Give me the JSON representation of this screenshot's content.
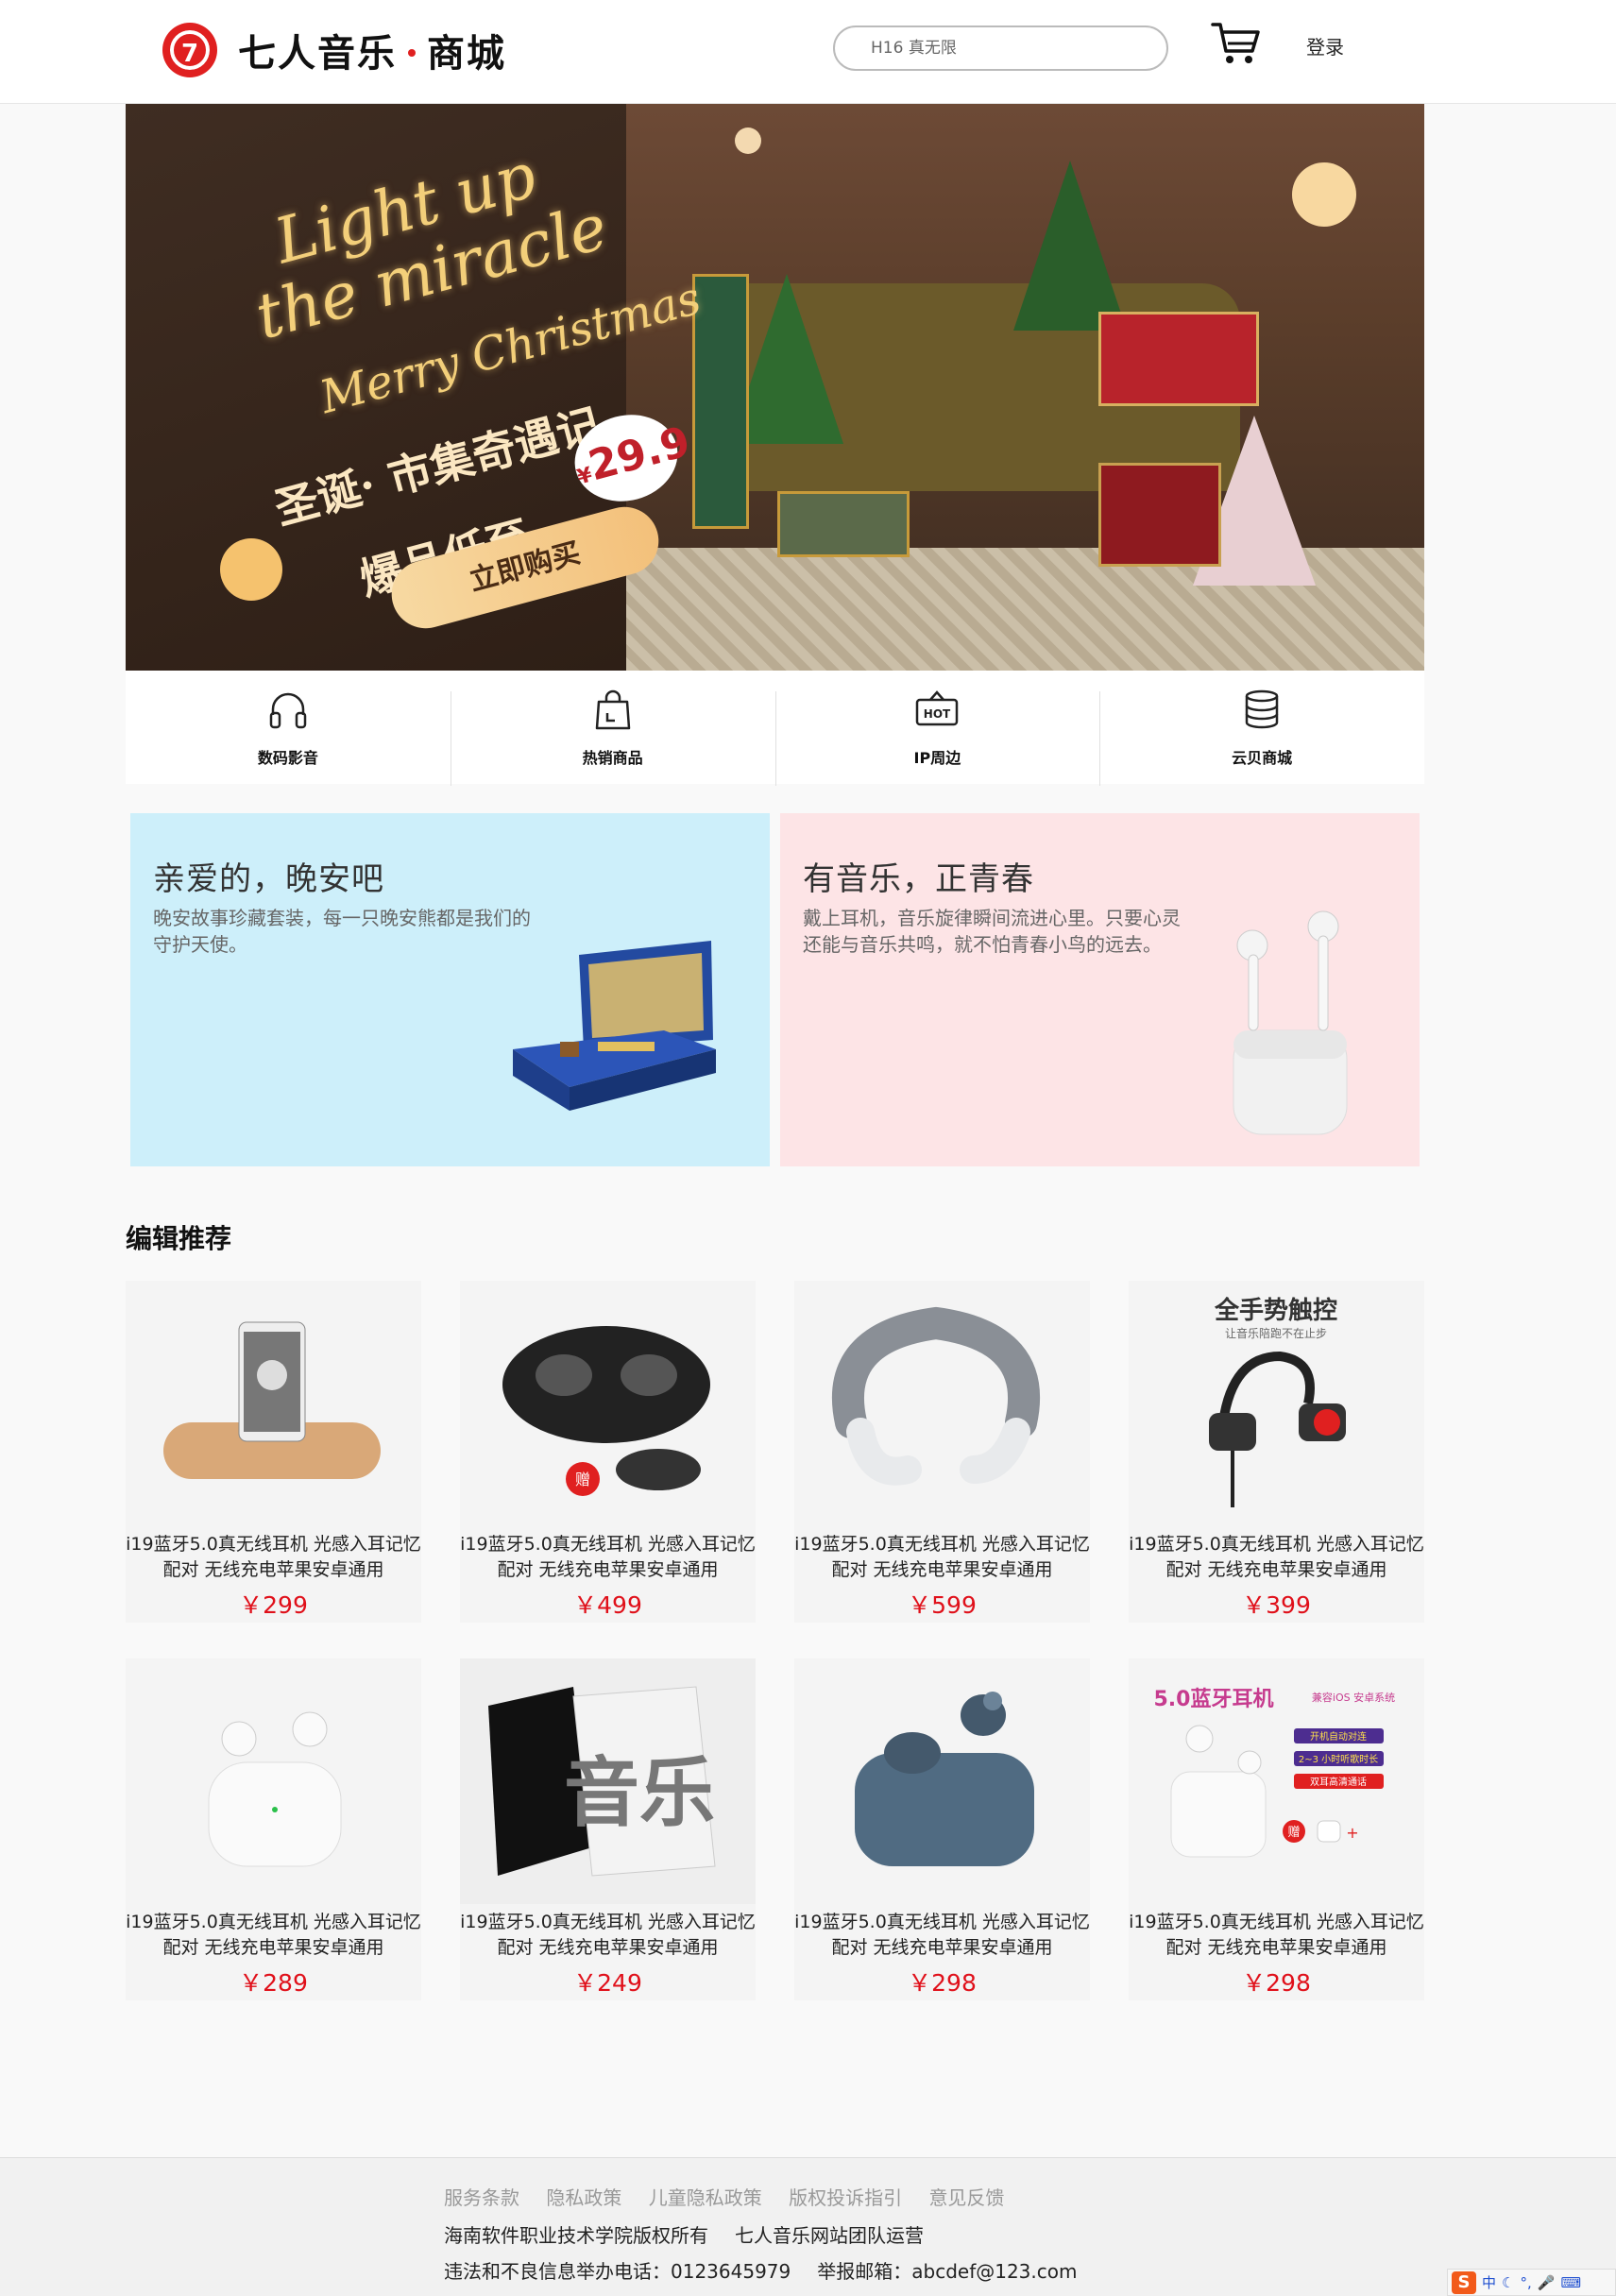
{
  "header": {
    "logo_mark": "7",
    "brand": "七人音乐",
    "brand_suffix": "商城",
    "search_placeholder": "H16 真无限",
    "login_label": "登录",
    "cart_icon": "cart-icon"
  },
  "banner": {
    "line1": "Light up",
    "line2": "the miracle",
    "line3": "Merry Christmas",
    "cn1": "圣诞· 市集奇遇记",
    "cn2": "爆品低至",
    "currency": "¥",
    "price": "29.9",
    "cta": "立即购买"
  },
  "categories": [
    {
      "label": "数码影音",
      "icon": "headphones-icon"
    },
    {
      "label": "热销商品",
      "icon": "shopping-bag-icon"
    },
    {
      "label": "IP周边",
      "icon": "hot-sign-icon"
    },
    {
      "label": "云贝商城",
      "icon": "coins-stack-icon"
    }
  ],
  "promos": [
    {
      "title": "亲爱的，晚安吧",
      "desc": "晚安故事珍藏套装，每一只晚安熊都是我们的守护天使。",
      "bg": "#cdeffa"
    },
    {
      "title": "有音乐，正青春",
      "desc": "戴上耳机，音乐旋律瞬间流进心里。只要心灵还能与音乐共鸣，就不怕青春小鸟的远去。",
      "bg": "#fde4e6"
    }
  ],
  "section_title": "编辑推荐",
  "products": [
    {
      "name": "i19蓝牙5.0真无线耳机 光感入耳记忆配对 无线充电苹果安卓通用",
      "price": "￥299"
    },
    {
      "name": "i19蓝牙5.0真无线耳机 光感入耳记忆配对 无线充电苹果安卓通用",
      "price": "￥499",
      "badge": "赠"
    },
    {
      "name": "i19蓝牙5.0真无线耳机 光感入耳记忆配对 无线充电苹果安卓通用",
      "price": "￥599"
    },
    {
      "name": "i19蓝牙5.0真无线耳机 光感入耳记忆配对 无线充电苹果安卓通用",
      "price": "￥399",
      "img_title": "全手势触控",
      "img_sub": "让音乐陪跑不在止步"
    },
    {
      "name": "i19蓝牙5.0真无线耳机 光感入耳记忆配对 无线充电苹果安卓通用",
      "price": "￥289"
    },
    {
      "name": "i19蓝牙5.0真无线耳机 光感入耳记忆配对 无线充电苹果安卓通用",
      "price": "￥249",
      "img_text": "音乐"
    },
    {
      "name": "i19蓝牙5.0真无线耳机 光感入耳记忆配对 无线充电苹果安卓通用",
      "price": "￥298"
    },
    {
      "name": "i19蓝牙5.0真无线耳机 光感入耳记忆配对 无线充电苹果安卓通用",
      "price": "￥298",
      "img_title": "5.0蓝牙耳机",
      "img_tag": "兼容iOS 安卓系统",
      "img_lines": [
        "开机自动对连",
        "2~3 小时听歌时长",
        "双耳高清通话"
      ],
      "badge": "赠"
    }
  ],
  "footer": {
    "links": [
      "服务条款",
      "隐私政策",
      "儿童隐私政策",
      "版权投诉指引",
      "意见反馈"
    ],
    "line2": [
      "海南软件职业技术学院版权所有",
      "七人音乐网站团队运营"
    ],
    "line3": [
      "违法和不良信息举办电话：0123645979",
      "举报邮箱：abcdef@123.com"
    ]
  },
  "ime": {
    "logo": "S",
    "mode": "中"
  },
  "colors": {
    "accent": "#e02020",
    "price": "#e0101a"
  }
}
